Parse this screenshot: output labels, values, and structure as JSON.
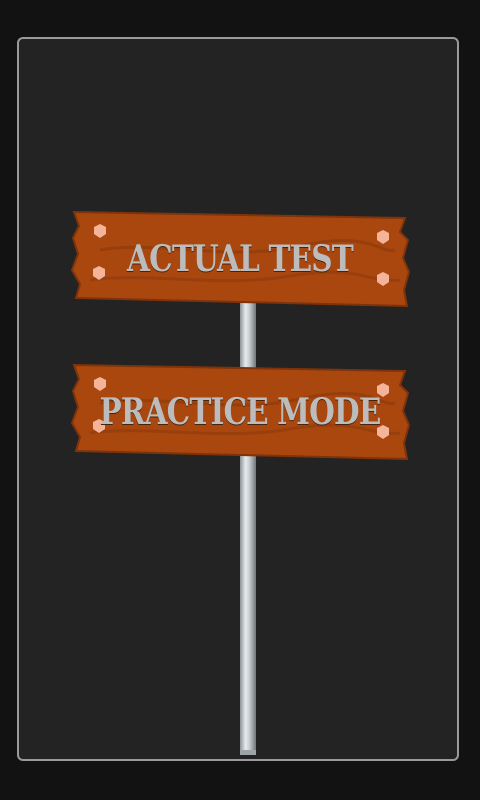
{
  "menu": {
    "actual_test_label": "ACTUAL TEST",
    "practice_mode_label": "PRACTICE MODE"
  },
  "colors": {
    "background": "#121212",
    "panel": "#232323",
    "panel_border": "#9a9a9a",
    "wood": "#a9470f",
    "wood_dark": "#7e330a",
    "nail": "#f5b49a",
    "label": "#bcbcbc",
    "pole": "#cfd4d6"
  },
  "icons": {
    "pole": "signpost-pole-icon",
    "nail": "nail-icon"
  }
}
